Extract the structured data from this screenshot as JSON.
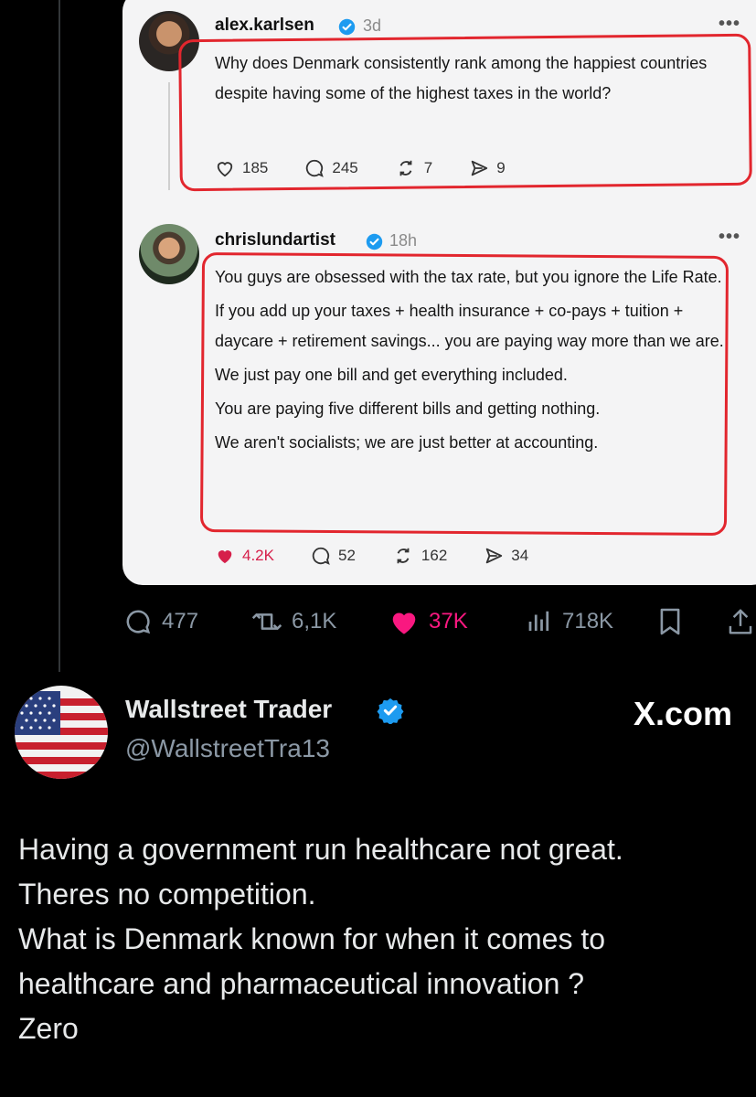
{
  "quoted_card": {
    "post1": {
      "username": "alex.karlsen",
      "time": "3d",
      "more": "•••",
      "text": "Why does Denmark consistently rank among the happiest countries despite having some of the highest taxes in the world?",
      "likes": "185",
      "comments": "245",
      "reposts": "7",
      "shares": "9"
    },
    "post2": {
      "username": "chrislundartist",
      "time": "18h",
      "more": "•••",
      "paragraphs": [
        "You guys are obsessed with the tax rate, but you ignore the Life Rate.",
        "If you add up your taxes + health insurance + co-pays + tuition + daycare + retirement savings... you are paying way more than we are.",
        "We just pay one bill and get everything included.",
        "You are paying five different bills and getting nothing.",
        "We aren't socialists; we are just better at accounting."
      ],
      "likes": "4.2K",
      "comments": "52",
      "reposts": "162",
      "shares": "34"
    },
    "colors": {
      "annotation_red": "#e2262e",
      "like_red": "#d61f4a",
      "verified_blue": "#1d9bf0"
    }
  },
  "post_actions": {
    "replies": "477",
    "reposts": "6,1K",
    "likes": "37K",
    "views": "718K"
  },
  "author": {
    "name": "Wallstreet Trader",
    "handle": "@WallstreetTra13",
    "watermark": "X.com"
  },
  "post": {
    "lines": [
      "Having a government run healthcare not great.",
      "Theres no competition.",
      "What is Denmark known for when it comes to",
      "healthcare and pharmaceutical innovation ?",
      "Zero"
    ]
  },
  "colors": {
    "background": "#000000",
    "like_pink": "#f91880",
    "muted": "#8b98a5"
  }
}
